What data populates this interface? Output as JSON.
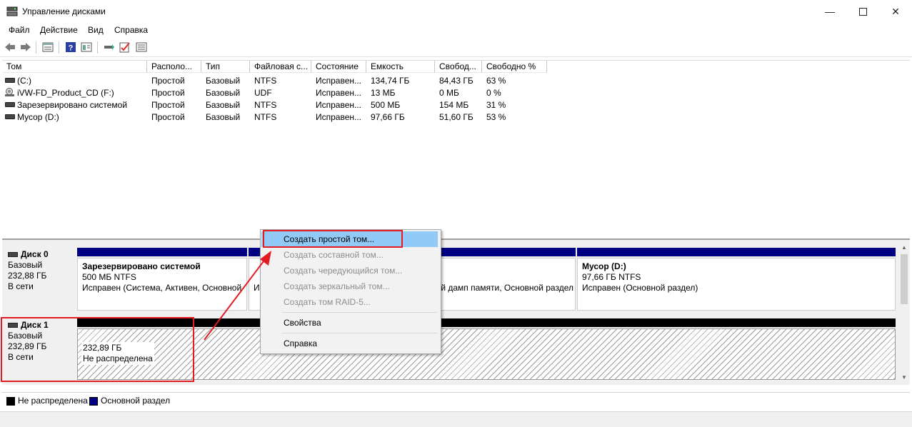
{
  "window": {
    "title": "Управление дисками"
  },
  "menu": [
    "Файл",
    "Действие",
    "Вид",
    "Справка"
  ],
  "toolbar": [
    "back-icon",
    "forward-icon",
    "list-view-icon",
    "help-icon",
    "properties-icon",
    "connect-icon",
    "check-icon",
    "settings-list-icon"
  ],
  "volumes": {
    "headers": [
      "Том",
      "Располо...",
      "Тип",
      "Файловая с...",
      "Состояние",
      "Емкость",
      "Свобод...",
      "Свободно %"
    ],
    "rows": [
      [
        "(C:)",
        "Простой",
        "Базовый",
        "NTFS",
        "Исправен...",
        "134,74 ГБ",
        "84,43 ГБ",
        "63 %"
      ],
      [
        "iVW-FD_Product_CD (F:)",
        "Простой",
        "Базовый",
        "UDF",
        "Исправен...",
        "13 МБ",
        "0 МБ",
        "0 %"
      ],
      [
        "Зарезервировано системой",
        "Простой",
        "Базовый",
        "NTFS",
        "Исправен...",
        "500 МБ",
        "154 МБ",
        "31 %"
      ],
      [
        "Мусор (D:)",
        "Простой",
        "Базовый",
        "NTFS",
        "Исправен...",
        "97,66 ГБ",
        "51,60 ГБ",
        "53 %"
      ]
    ]
  },
  "disks": [
    {
      "name": "Диск 0",
      "type": "Базовый",
      "size": "232,88 ГБ",
      "status": "В сети",
      "partitions": [
        {
          "title": "Зарезервировано системой",
          "size": "500 МБ NTFS",
          "status": "Исправен (Система, Активен, Основной"
        },
        {
          "title": "",
          "size": "",
          "status": "Исправен (Загрузка, Файл подкачки, Аварийный дамп памяти, Основной раздел"
        },
        {
          "title": "Мусор  (D:)",
          "size": "97,66 ГБ NTFS",
          "status": "Исправен (Основной раздел)"
        }
      ]
    },
    {
      "name": "Диск 1",
      "type": "Базовый",
      "size": "232,89 ГБ",
      "status": "В сети",
      "partitions": [
        {
          "title": "",
          "size": "232,89 ГБ",
          "status": "Не распределена"
        }
      ]
    }
  ],
  "legend": [
    {
      "label": "Не распределена",
      "color": "#000000"
    },
    {
      "label": "Основной раздел",
      "color": "#000080"
    }
  ],
  "context_menu": {
    "items": [
      {
        "label": "Создать простой том...",
        "enabled": true,
        "highlighted": true
      },
      {
        "label": "Создать составной том...",
        "enabled": false
      },
      {
        "label": "Создать чередующийся том...",
        "enabled": false
      },
      {
        "label": "Создать зеркальный том...",
        "enabled": false
      },
      {
        "label": "Создать том RAID-5...",
        "enabled": false
      },
      {
        "label": "Свойства",
        "enabled": true
      },
      {
        "label": "Справка",
        "enabled": true
      }
    ]
  },
  "colors": {
    "annotation": "#e31c24",
    "highlight": "#91c9f7",
    "primary_partition": "#000080"
  }
}
